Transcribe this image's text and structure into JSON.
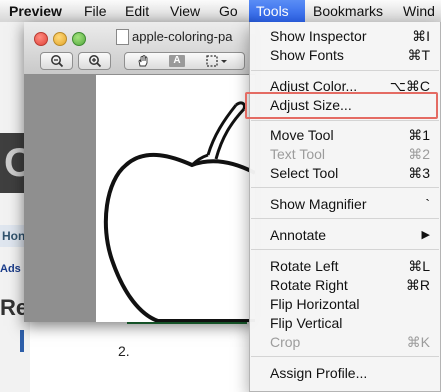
{
  "menubar": {
    "app": "Preview",
    "items": [
      "File",
      "Edit",
      "View",
      "Go",
      "Tools",
      "Bookmarks",
      "Wind"
    ]
  },
  "background_page": {
    "letter": "O",
    "tab_label": "Hon",
    "ads_text": "Ads b",
    "heading": "Re",
    "list_number": "2."
  },
  "window": {
    "title": "apple-coloring-pa",
    "toolbar": {
      "zoom_out": "−",
      "zoom_in": "+",
      "text_tool": "A"
    }
  },
  "tools_menu": {
    "items": [
      {
        "label": "Show Inspector",
        "shortcut": "⌘I",
        "enabled": true
      },
      {
        "label": "Show Fonts",
        "shortcut": "⌘T",
        "enabled": true
      },
      {
        "label": "Adjust Color...",
        "shortcut": "⌥⌘C",
        "enabled": true
      },
      {
        "label": "Adjust Size...",
        "shortcut": "",
        "enabled": true
      },
      {
        "label": "Move Tool",
        "shortcut": "⌘1",
        "enabled": true
      },
      {
        "label": "Text Tool",
        "shortcut": "⌘2",
        "enabled": false
      },
      {
        "label": "Select Tool",
        "shortcut": "⌘3",
        "enabled": true
      },
      {
        "label": "Show Magnifier",
        "shortcut": "`",
        "enabled": true
      },
      {
        "label": "Annotate",
        "shortcut": "▶",
        "enabled": true
      },
      {
        "label": "Rotate Left",
        "shortcut": "⌘L",
        "enabled": true
      },
      {
        "label": "Rotate Right",
        "shortcut": "⌘R",
        "enabled": true
      },
      {
        "label": "Flip Horizontal",
        "shortcut": "",
        "enabled": true
      },
      {
        "label": "Flip Vertical",
        "shortcut": "",
        "enabled": true
      },
      {
        "label": "Crop",
        "shortcut": "⌘K",
        "enabled": false
      },
      {
        "label": "Assign Profile...",
        "shortcut": "",
        "enabled": true
      }
    ]
  },
  "colors": {
    "menu_highlight": "#2b61e8",
    "callout_border": "#e46b63"
  }
}
